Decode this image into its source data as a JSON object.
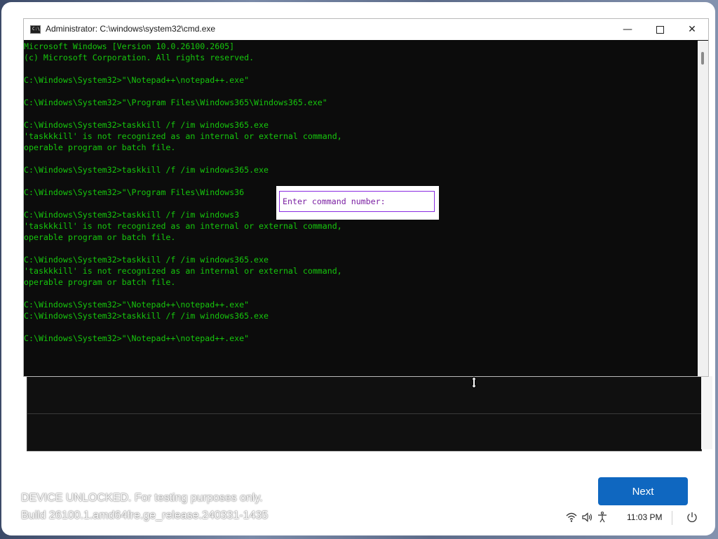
{
  "window": {
    "title": "Administrator: C:\\windows\\system32\\cmd.exe",
    "icon_label": "C:\\",
    "minimize": "—",
    "close": "✕"
  },
  "console": {
    "lines": [
      "Microsoft Windows [Version 10.0.26100.2605]",
      "(c) Microsoft Corporation. All rights reserved.",
      "",
      "C:\\Windows\\System32>\"\\Notepad++\\notepad++.exe\"",
      "",
      "C:\\Windows\\System32>\"\\Program Files\\Windows365\\Windows365.exe\"",
      "",
      "C:\\Windows\\System32>taskkill /f /im windows365.exe",
      "'taskkkill' is not recognized as an internal or external command,",
      "operable program or batch file.",
      "",
      "C:\\Windows\\System32>taskkill /f /im windows365.exe",
      "",
      "C:\\Windows\\System32>\"\\Program Files\\Windows36",
      "",
      "C:\\Windows\\System32>taskkill /f /im windows3",
      "'taskkkill' is not recognized as an internal or external command,",
      "operable program or batch file.",
      "",
      "C:\\Windows\\System32>taskkill /f /im windows365.exe",
      "'taskkkill' is not recognized as an internal or external command,",
      "operable program or batch file.",
      "",
      "C:\\Windows\\System32>\"\\Notepad++\\notepad++.exe\"",
      "C:\\Windows\\System32>taskkill /f /im windows365.exe",
      "",
      "C:\\Windows\\System32>\"\\Notepad++\\notepad++.exe\""
    ]
  },
  "prompt": {
    "label": "Enter command number:"
  },
  "footer": {
    "watermark_line1": "DEVICE UNLOCKED. For testing purposes only.",
    "watermark_line2": "Build 26100.1.amd64fre.ge_release.240331-1435",
    "next_label": "Next",
    "time": "11:03 PM"
  },
  "icons": [
    "wifi-icon",
    "volume-icon",
    "accessibility-icon",
    "power-icon",
    "resize-cursor-icon"
  ],
  "colors": {
    "console_text": "#16c60c",
    "console_bg": "#0c0c0c",
    "prompt_text": "#7a1fa2",
    "accent": "#0f67c0"
  }
}
